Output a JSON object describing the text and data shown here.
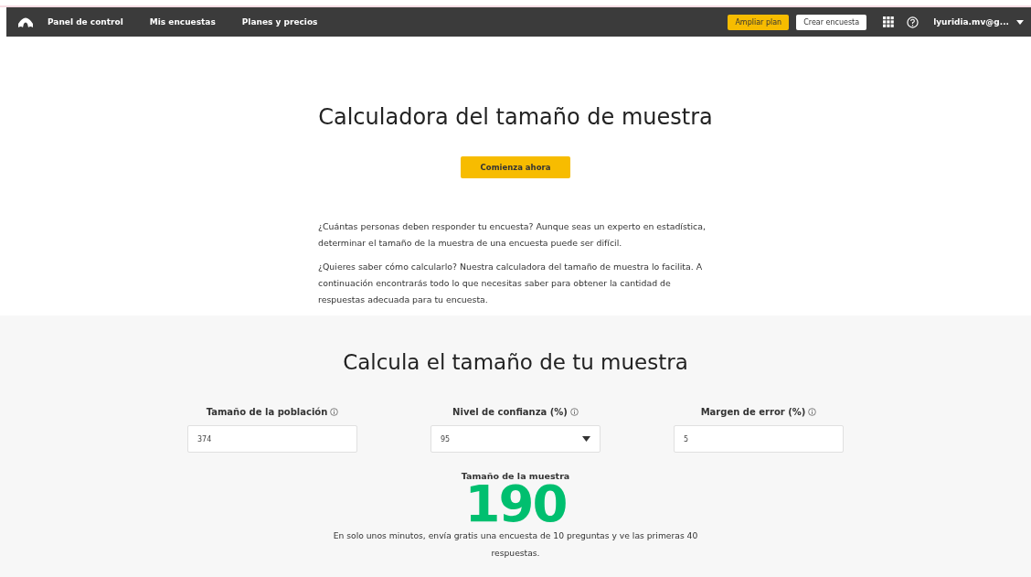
{
  "nav": {
    "links": [
      {
        "label": "Panel de control"
      },
      {
        "label": "Mis encuestas"
      },
      {
        "label": "Planes y precios"
      }
    ],
    "upgrade_button": "Ampliar plan",
    "create_button": "Crear encuesta",
    "user": "lyuridia.mv@g..."
  },
  "hero": {
    "title": "Calculadora del tamaño de muestra",
    "cta": "Comienza ahora",
    "paragraphs": [
      "¿Cuántas personas deben responder tu encuesta? Aunque seas un experto en estadística, determinar el tamaño de la muestra de una encuesta puede ser difícil.",
      "¿Quieres saber cómo calcularlo? Nuestra calculadora del tamaño de muestra lo facilita. A continuación encontrarás todo lo que necesitas saber para obtener la cantidad de respuestas adecuada para tu encuesta."
    ]
  },
  "calculator": {
    "title": "Calcula el tamaño de tu muestra",
    "fields": [
      {
        "kind": "input",
        "label": "Tamaño de la población",
        "value": "374"
      },
      {
        "kind": "select",
        "label": "Nivel de confianza (%)",
        "value": "95"
      },
      {
        "kind": "input",
        "label": "Margen de error (%)",
        "value": "5"
      }
    ],
    "result_label": "Tamaño de la muestra",
    "result": "190",
    "note": "En solo unos minutos, envía gratis una encuesta de 10 preguntas y ve las primeras 40 respuestas."
  }
}
